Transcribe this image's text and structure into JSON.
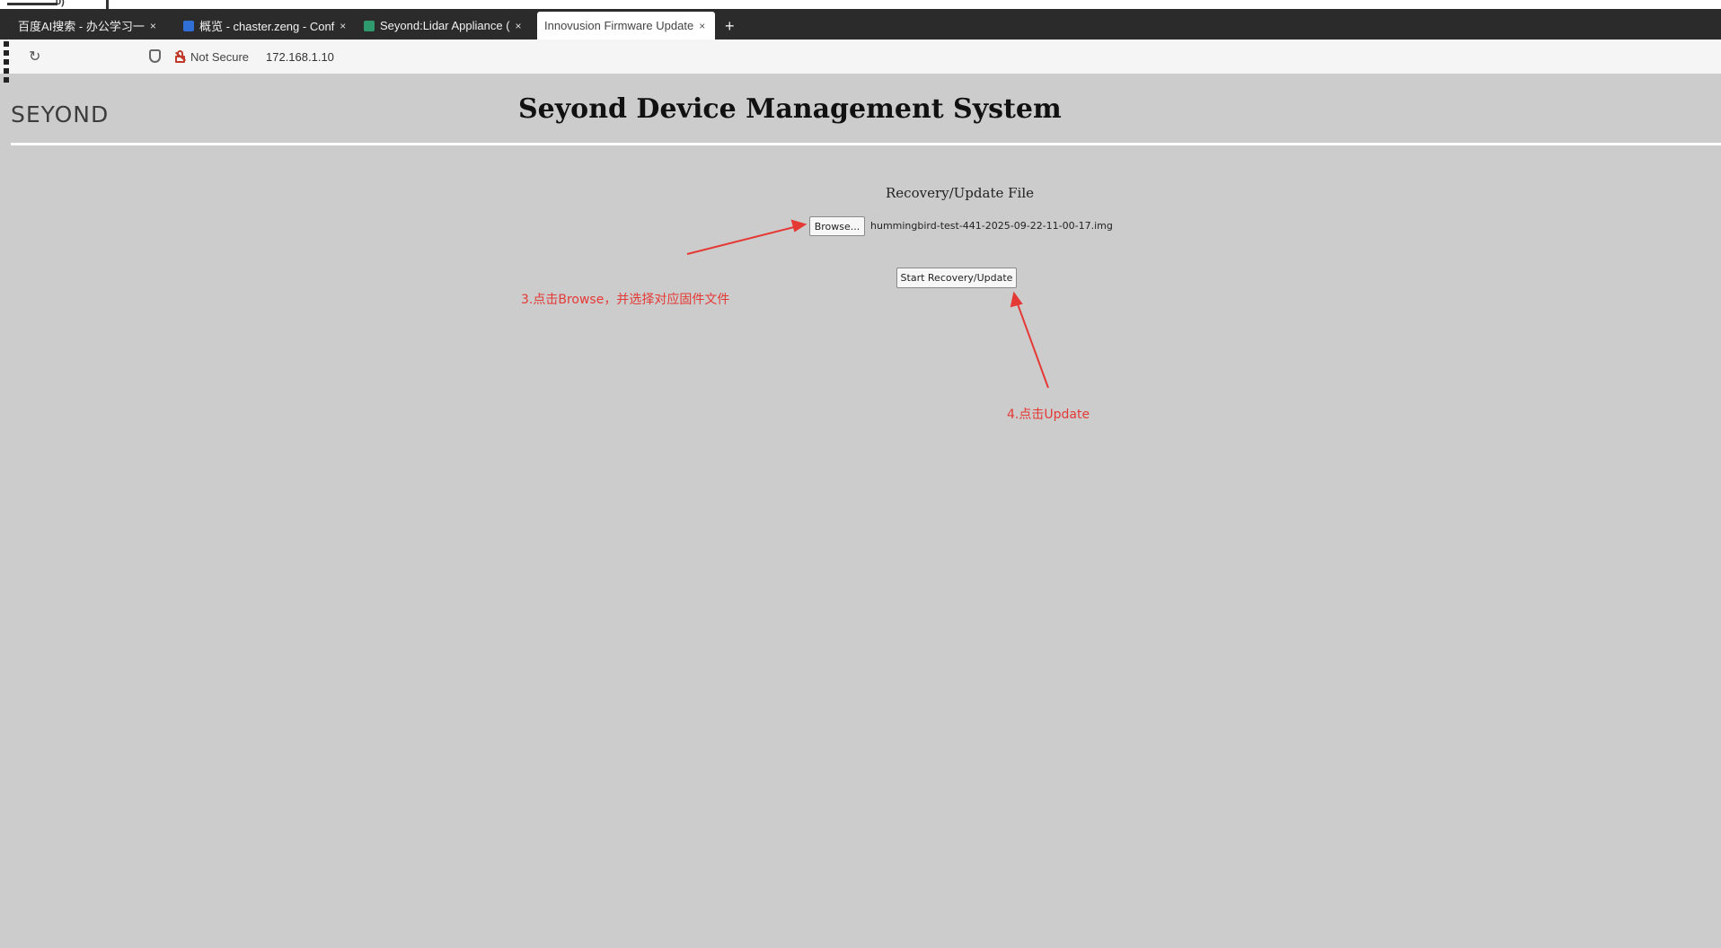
{
  "browser": {
    "top_strip_text": "0)",
    "tabs": [
      {
        "label": "百度AI搜索 - 办公学习一",
        "favicon_color": "#2b2b2b",
        "active": false
      },
      {
        "label": "概览 - chaster.zeng - Conf",
        "favicon_color": "#2f6fd6",
        "active": false
      },
      {
        "label": "Seyond:Lidar Appliance (",
        "favicon_color": "#2e9a6e",
        "active": false
      },
      {
        "label": "Innovusion Firmware Update",
        "favicon_color": "",
        "active": true
      }
    ],
    "tab_close_glyph": "×",
    "new_tab_glyph": "+",
    "address": {
      "security_label": "Not Secure",
      "url": "172.168.1.10"
    }
  },
  "header": {
    "logo_text": "SEYOND",
    "title": "Seyond Device Management System"
  },
  "main": {
    "file_section_title": "Recovery/Update File",
    "browse_label": "Browse...",
    "selected_file": "hummingbird-test-441-2025-09-22-11-00-17.img",
    "start_button_label": "Start Recovery/Update"
  },
  "annotations": {
    "step3": "3.点击Browse，并选择对应固件文件",
    "step4": "4.点击Update",
    "color": "#e53935"
  }
}
